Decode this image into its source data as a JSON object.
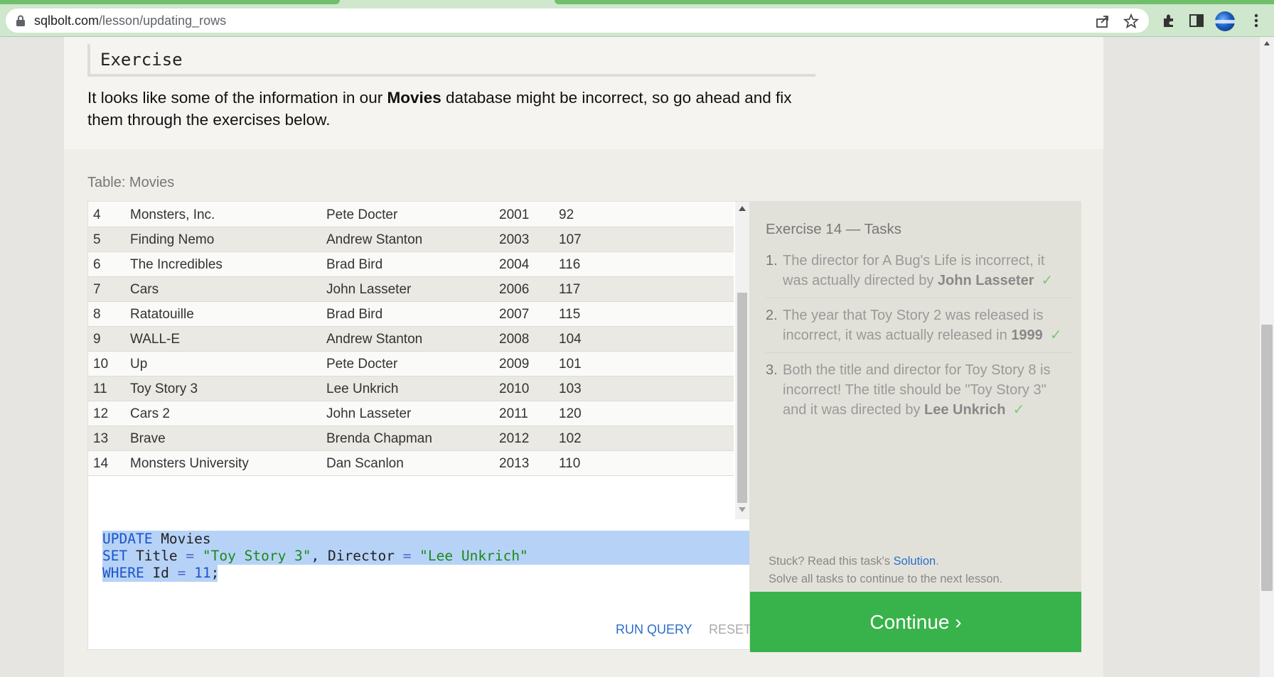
{
  "browser": {
    "url_domain": "sqlbolt.com",
    "url_path": "/lesson/updating_rows"
  },
  "exercise": {
    "heading": "Exercise",
    "intro_before": "It looks like some of the information in our ",
    "intro_bold": "Movies",
    "intro_after": " database might be incorrect, so go ahead and fix them through the exercises below."
  },
  "table": {
    "caption": "Table: Movies",
    "rows": [
      {
        "id": "4",
        "title": "Monsters, Inc.",
        "director": "Pete Docter",
        "year": "2001",
        "length": "92"
      },
      {
        "id": "5",
        "title": "Finding Nemo",
        "director": "Andrew Stanton",
        "year": "2003",
        "length": "107"
      },
      {
        "id": "6",
        "title": "The Incredibles",
        "director": "Brad Bird",
        "year": "2004",
        "length": "116"
      },
      {
        "id": "7",
        "title": "Cars",
        "director": "John Lasseter",
        "year": "2006",
        "length": "117"
      },
      {
        "id": "8",
        "title": "Ratatouille",
        "director": "Brad Bird",
        "year": "2007",
        "length": "115"
      },
      {
        "id": "9",
        "title": "WALL-E",
        "director": "Andrew Stanton",
        "year": "2008",
        "length": "104"
      },
      {
        "id": "10",
        "title": "Up",
        "director": "Pete Docter",
        "year": "2009",
        "length": "101"
      },
      {
        "id": "11",
        "title": "Toy Story 3",
        "director": "Lee Unkrich",
        "year": "2010",
        "length": "103"
      },
      {
        "id": "12",
        "title": "Cars 2",
        "director": "John Lasseter",
        "year": "2011",
        "length": "120"
      },
      {
        "id": "13",
        "title": "Brave",
        "director": "Brenda Chapman",
        "year": "2012",
        "length": "102"
      },
      {
        "id": "14",
        "title": "Monsters University",
        "director": "Dan Scanlon",
        "year": "2013",
        "length": "110"
      }
    ]
  },
  "editor": {
    "line1_kw": "UPDATE",
    "line1_rest": " Movies",
    "line2_kw": "SET",
    "line2_a": " Title ",
    "line2_eq1": "=",
    "line2_s1": " \"Toy Story 3\"",
    "line2_b": ", Director ",
    "line2_eq2": "=",
    "line2_s2": " \"Lee Unkrich\"",
    "line3_kw": "WHERE",
    "line3_a": " Id ",
    "line3_eq": "=",
    "line3_num": " 11",
    "line3_end": ";",
    "run_label": "RUN QUERY",
    "reset_label": "RESET"
  },
  "tasks": {
    "title": "Exercise 14 — Tasks",
    "items": [
      {
        "num": "1.",
        "text": "The director for A Bug's Life is incorrect, it was actually directed by ",
        "bold": "John Lasseter",
        "check": "✓"
      },
      {
        "num": "2.",
        "text": "The year that Toy Story 2 was released is incorrect, it was actually released in ",
        "bold": "1999",
        "check": "✓"
      },
      {
        "num": "3.",
        "text": "Both the title and director for Toy Story 8 is incorrect! The title should be \"Toy Story 3\" and it was directed by ",
        "bold": "Lee Unkrich",
        "check": "✓"
      }
    ],
    "help_prefix": "Stuck? Read this task's ",
    "help_link": "Solution",
    "help_suffix": ".",
    "help_line2": "Solve all tasks to continue to the next lesson."
  },
  "continue_label": "Continue ›",
  "colors": {
    "continue": "#38b24a",
    "link": "#2b6ec9",
    "keyword": "#1a55c9",
    "string": "#1a8a1a",
    "selection": "#b7d2f7"
  }
}
